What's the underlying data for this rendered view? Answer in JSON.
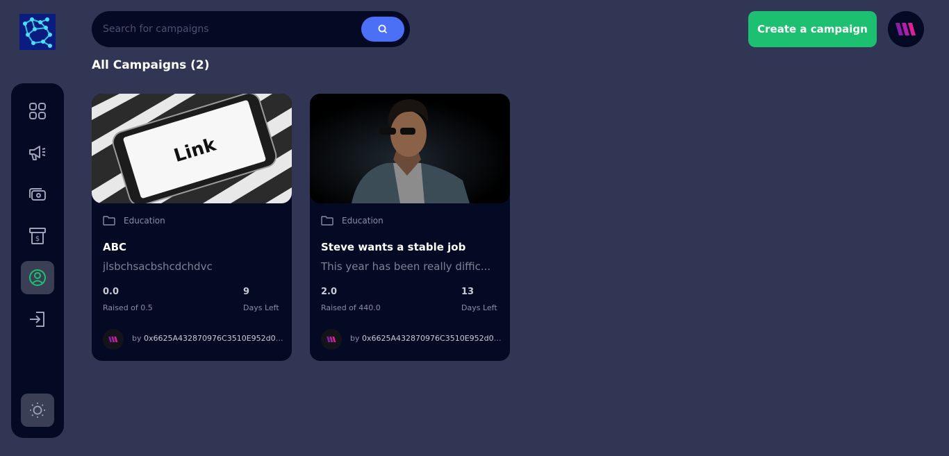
{
  "search": {
    "placeholder": "Search for campaigns"
  },
  "header": {
    "create_label": "Create a campaign"
  },
  "heading": "All Campaigns (2)",
  "colors": {
    "background": "#303653",
    "panel": "#050a24",
    "accent_green": "#1dc071",
    "accent_blue": "#4b6ff5",
    "brand_pink": "#c81ea0"
  },
  "sidebar": {
    "items": [
      {
        "icon": "dashboard-grid-icon"
      },
      {
        "icon": "megaphone-icon"
      },
      {
        "icon": "money-icon"
      },
      {
        "icon": "withdraw-icon"
      },
      {
        "icon": "profile-icon",
        "active": true
      },
      {
        "icon": "logout-icon"
      }
    ],
    "theme_icon": "sun-icon"
  },
  "campaigns": [
    {
      "category": "Education",
      "title": "ABC",
      "description": "jlsbchsacbshcdchdvc",
      "raised": "0.0",
      "raised_label": "Raised of 0.5",
      "days": "9",
      "days_label": "Days Left",
      "by": "by ",
      "owner": "0x6625A432870976C3510E952d0E...",
      "image": "phone-link-image"
    },
    {
      "category": "Education",
      "title": "Steve wants a stable job",
      "description": "This year has been really diffic...",
      "raised": "2.0",
      "raised_label": "Raised of 440.0",
      "days": "13",
      "days_label": "Days Left",
      "by": "by ",
      "owner": "0x6625A432870976C3510E952d0E...",
      "image": "portrait-man-sunglasses-image"
    }
  ]
}
